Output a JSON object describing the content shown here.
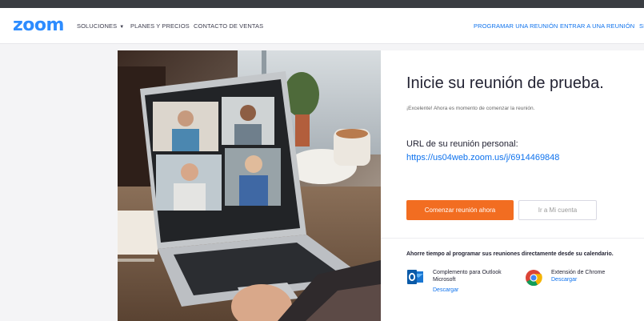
{
  "header": {
    "logo": "zoom",
    "nav": {
      "soluciones": "SOLUCIONES",
      "planes": "PLANES Y PRECIOS",
      "contacto": "CONTACTO DE VENTAS",
      "programar": "PROGRAMAR UNA REUNIÓN",
      "entrar": "ENTRAR A UNA REUNIÓN",
      "cut": "SI"
    }
  },
  "main": {
    "title": "Inicie su reunión de prueba.",
    "subtitle": "¡Excelente! Ahora es momento de comenzar la reunión.",
    "url_label": "URL de su reunión personal:",
    "url": "https://us04web.zoom.us/j/6914469848",
    "start_button": "Comenzar reunión ahora",
    "account_button": "Ir a Mi cuenta"
  },
  "footer": {
    "ahorre": "Ahorre tiempo al programar sus reuniones directamente desde su calendario.",
    "outlook": {
      "name_line1": "Complemento para Outlook",
      "name_line2": "Microsoft",
      "link": "Descargar",
      "icon": "outlook-icon"
    },
    "chrome": {
      "name": "Extensión de Chrome",
      "link": "Descargar",
      "icon": "chrome-icon"
    }
  },
  "colors": {
    "brand": "#2d8cff",
    "link": "#0e72ed",
    "start_button": "#f26d21"
  }
}
